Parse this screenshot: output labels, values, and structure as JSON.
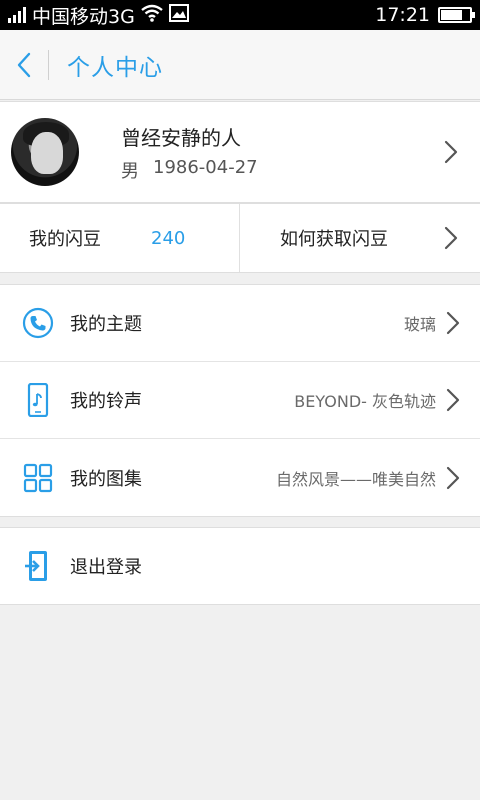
{
  "status_bar": {
    "carrier": "中国移动3G",
    "time": "17:21",
    "signal_icon": "signal-icon",
    "wifi_icon": "wifi-icon",
    "image_icon": "image-notification-icon",
    "battery_icon": "battery-icon",
    "battery_level": 0.75
  },
  "title_bar": {
    "title": "个人中心",
    "back_icon": "chevron-left-icon"
  },
  "profile": {
    "name": "曾经安静的人",
    "gender": "男",
    "birthday": "1986-04-27"
  },
  "beans": {
    "label": "我的闪豆",
    "count": "240",
    "how_to": "如何获取闪豆"
  },
  "menu": {
    "items": [
      {
        "label": "我的主题",
        "value": "玻璃",
        "icon": "phone-icon"
      },
      {
        "label": "我的铃声",
        "value": "BEYOND- 灰色轨迹",
        "icon": "ringtone-icon"
      },
      {
        "label": "我的图集",
        "value": "自然风景——唯美自然",
        "icon": "grid-icon"
      }
    ]
  },
  "logout": {
    "label": "退出登录",
    "icon": "logout-icon"
  },
  "colors": {
    "accent": "#2a9ee7",
    "background": "#f0f0f0"
  }
}
